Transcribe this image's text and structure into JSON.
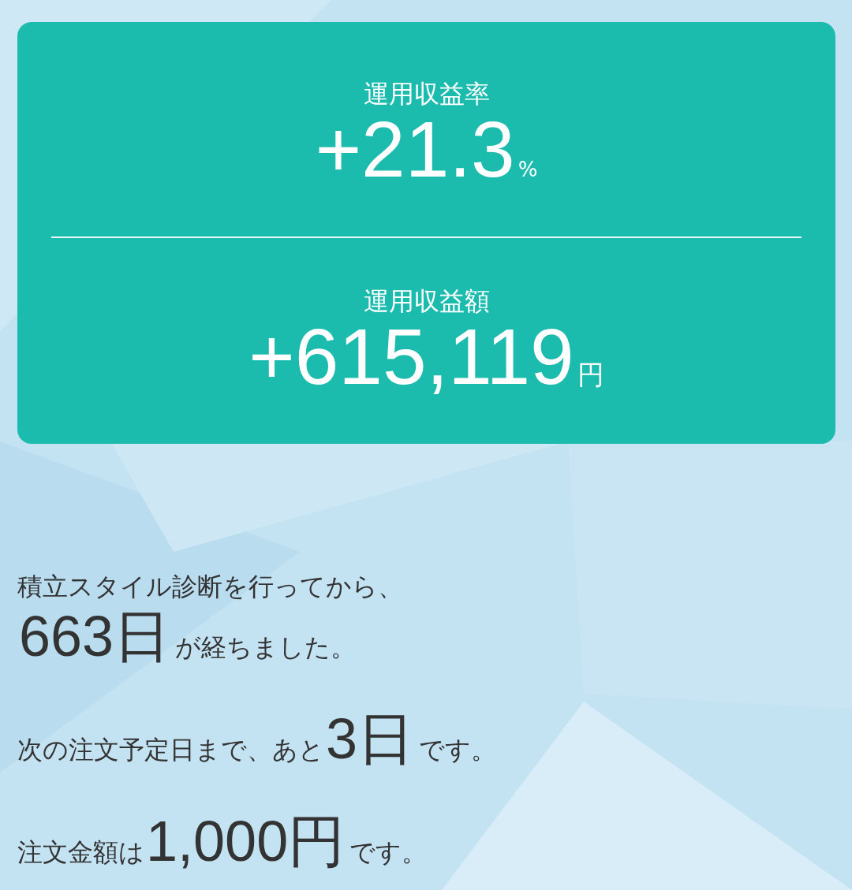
{
  "summary_card": {
    "metrics": [
      {
        "label": "運用収益率",
        "value": "+21.3",
        "unit": "%"
      },
      {
        "label": "運用収益額",
        "value": "+615,119",
        "unit": "円"
      }
    ]
  },
  "messages": [
    {
      "lines": [
        [
          {
            "kind": "normal",
            "text": "積立スタイル診断を行ってから、"
          }
        ],
        [
          {
            "kind": "big",
            "text": "663日"
          },
          {
            "kind": "normal",
            "text": "が経ちました。"
          }
        ]
      ]
    },
    {
      "lines": [
        [
          {
            "kind": "normal",
            "text": "次の注文予定日まで、あと"
          },
          {
            "kind": "big",
            "text": "3日"
          },
          {
            "kind": "normal",
            "text": "です。"
          }
        ]
      ]
    },
    {
      "lines": [
        [
          {
            "kind": "normal",
            "text": "注文金額は"
          },
          {
            "kind": "big",
            "text": "1,000円"
          },
          {
            "kind": "normal",
            "text": "です。"
          }
        ]
      ]
    }
  ]
}
